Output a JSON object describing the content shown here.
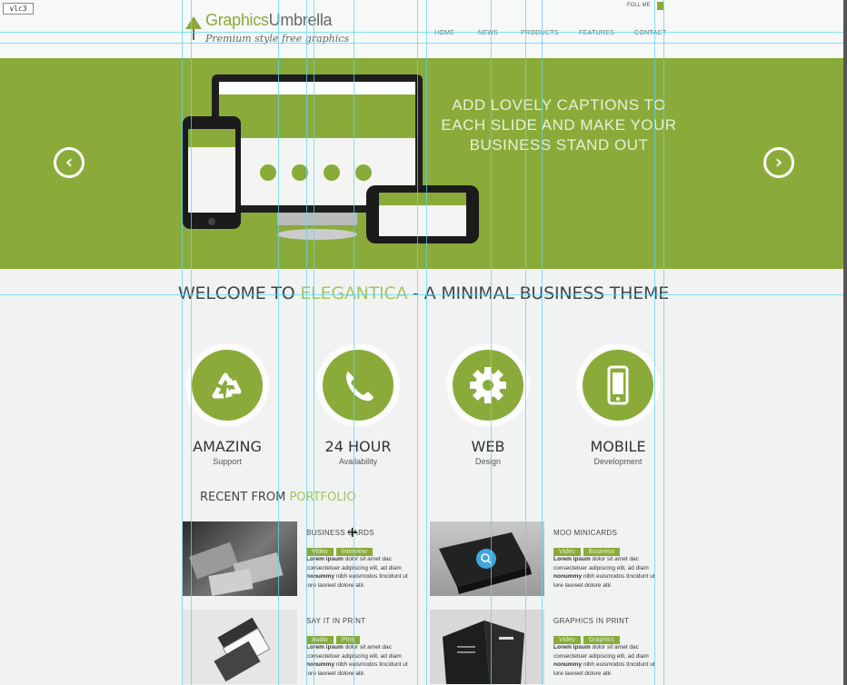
{
  "header": {
    "badge": "vlc3",
    "logo_part1": "Graphics",
    "logo_part2": "Umbrella",
    "tagline": "Premium style free graphics",
    "follow": "FOLL ME",
    "nav": [
      "HOME",
      "NEWS",
      "PRODUCTS",
      "FEATURES",
      "CONTACT"
    ]
  },
  "slider": {
    "caption_lines": [
      "ADD LOVELY CAPTIONS TO",
      "EACH SLIDE AND MAKE YOUR",
      "BUSINESS STAND OUT"
    ],
    "prev_glyph": "‹",
    "next_glyph": "›"
  },
  "welcome": {
    "prefix": "WELCOME TO ",
    "highlight": "ELEGANTICA",
    "suffix": " - A MINIMAL BUSINESS THEME"
  },
  "features": [
    {
      "icon": "recycle-icon",
      "title": "AMAZING",
      "subtitle": "Support"
    },
    {
      "icon": "phone-icon",
      "title": "24 HOUR",
      "subtitle": "Availability"
    },
    {
      "icon": "gear-icon",
      "title": "WEB",
      "subtitle": "Design"
    },
    {
      "icon": "mobile-icon",
      "title": "MOBILE",
      "subtitle": "Development"
    }
  ],
  "portfolio": {
    "heading_prefix": "RECENT FROM ",
    "heading_highlight": "PORTFOLIO",
    "lorem_bold1": "Lorem ipsum",
    "lorem_1": " dolor sit amet dac consectetuer adipiscing elit, ad diam ",
    "lorem_bold2": "nonummy",
    "lorem_2": " nibh euismodos tincidunt ut lore laoreet dolore atir.",
    "items": [
      {
        "title": "BUSINESS CARDS",
        "tags": [
          "Video",
          "Interview"
        ]
      },
      {
        "title": "MOO MINICARDS",
        "tags": [
          "Video",
          "Business"
        ]
      },
      {
        "title": "SAY IT IN PRINT",
        "tags": [
          "Audio",
          "Print"
        ]
      },
      {
        "title": "GRAPHICS IN PRINT",
        "tags": [
          "Video",
          "Graphics"
        ]
      }
    ]
  },
  "colors": {
    "accent": "#8aab3a",
    "highlight": "#a6c35c",
    "guide": "#5fd6f0"
  }
}
